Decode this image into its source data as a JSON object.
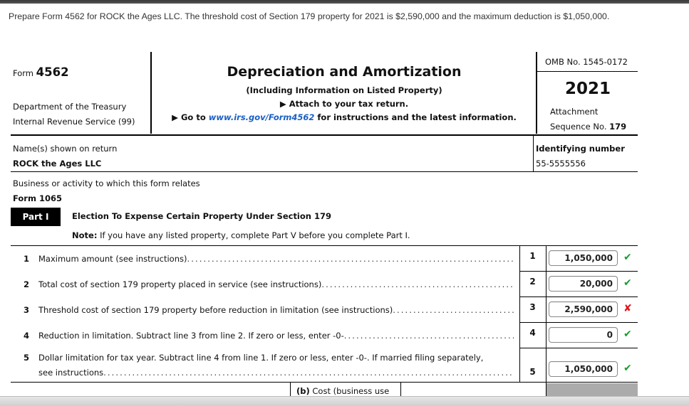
{
  "prompt": {
    "text": "Prepare Form 4562 for ROCK the Ages LLC. The threshold cost of Section 179 property for 2021 is $2,590,000 and the maximum deduction is $1,050,000."
  },
  "header": {
    "form_prefix": "Form",
    "form_number": "4562",
    "dept_line1": "Department of the Treasury",
    "dept_line2": "Internal Revenue Service (99)",
    "title": "Depreciation and Amortization",
    "subtitle": "(Including Information on Listed Property)",
    "attach": "▶ Attach to your tax return.",
    "goto_prefix": "▶ Go to ",
    "goto_link": "www.irs.gov/Form4562",
    "goto_suffix": " for instructions and the latest information.",
    "omb": "OMB No. 1545-0172",
    "year": "2021",
    "attachment_label": "Attachment",
    "sequence_label": "Sequence No.",
    "sequence_number": "179"
  },
  "taxpayer": {
    "name_label": "Name(s) shown on return",
    "name_value": "ROCK the Ages LLC",
    "id_label": "Identifying number",
    "id_value": "55-5555556",
    "business_label": "Business or activity to which this form relates",
    "business_value": "Form 1065"
  },
  "part1": {
    "badge": "Part I",
    "title": "Election To Expense Certain Property Under Section 179",
    "note_bold": "Note:",
    "note_text": " If you have any listed property, complete Part V before you complete Part I.",
    "lines": [
      {
        "num": "1",
        "text": "Maximum amount (see instructions)",
        "value": "1,050,000",
        "status": "correct"
      },
      {
        "num": "2",
        "text": "Total cost of section 179 property placed in service (see instructions)",
        "value": "20,000",
        "status": "correct"
      },
      {
        "num": "3",
        "text": "Threshold cost of section 179 property before reduction in limitation (see instructions)",
        "value": "2,590,000",
        "status": "incorrect"
      },
      {
        "num": "4",
        "text": "Reduction in limitation. Subtract line 3 from line 2. If zero or less, enter -0-",
        "value": "0",
        "status": "correct"
      },
      {
        "num": "5",
        "text": "Dollar limitation for tax year. Subtract line 4 from line 1. If zero or less, enter -0-. If married filing separately,",
        "text2": "see instructions",
        "value": "1,050,000",
        "status": "correct"
      }
    ],
    "marks": {
      "correct": "✔",
      "incorrect": "✘"
    },
    "dots": "................................................................................................................",
    "col_b_bold": "(b)",
    "col_b_text": " Cost (business use"
  }
}
